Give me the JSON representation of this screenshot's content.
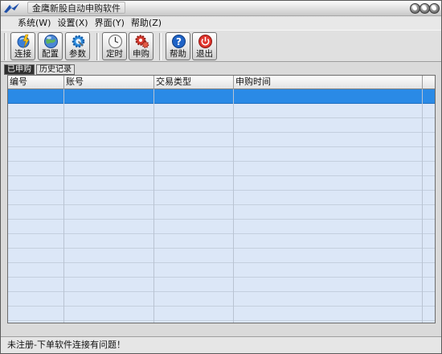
{
  "window": {
    "title": "金鹰新股自动申购软件"
  },
  "menu": [
    {
      "label": "系统(W)"
    },
    {
      "label": "设置(X)"
    },
    {
      "label": "界面(Y)"
    },
    {
      "label": "帮助(Z)"
    }
  ],
  "toolbar": {
    "connect": "连接",
    "config": "配置",
    "params": "参数",
    "timer": "定时",
    "apply": "申购",
    "help": "帮助",
    "exit": "退出"
  },
  "tabs": [
    {
      "label": "已申购",
      "active": true
    },
    {
      "label": "历史记录",
      "active": false
    }
  ],
  "grid": {
    "columns": [
      "编号",
      "账号",
      "交易类型",
      "申购时间"
    ],
    "rows": []
  },
  "status": {
    "text": "未注册-下单软件连接有问题！"
  },
  "colors": {
    "selection": "#2a8ae6",
    "grid_background": "#dce7f7"
  }
}
